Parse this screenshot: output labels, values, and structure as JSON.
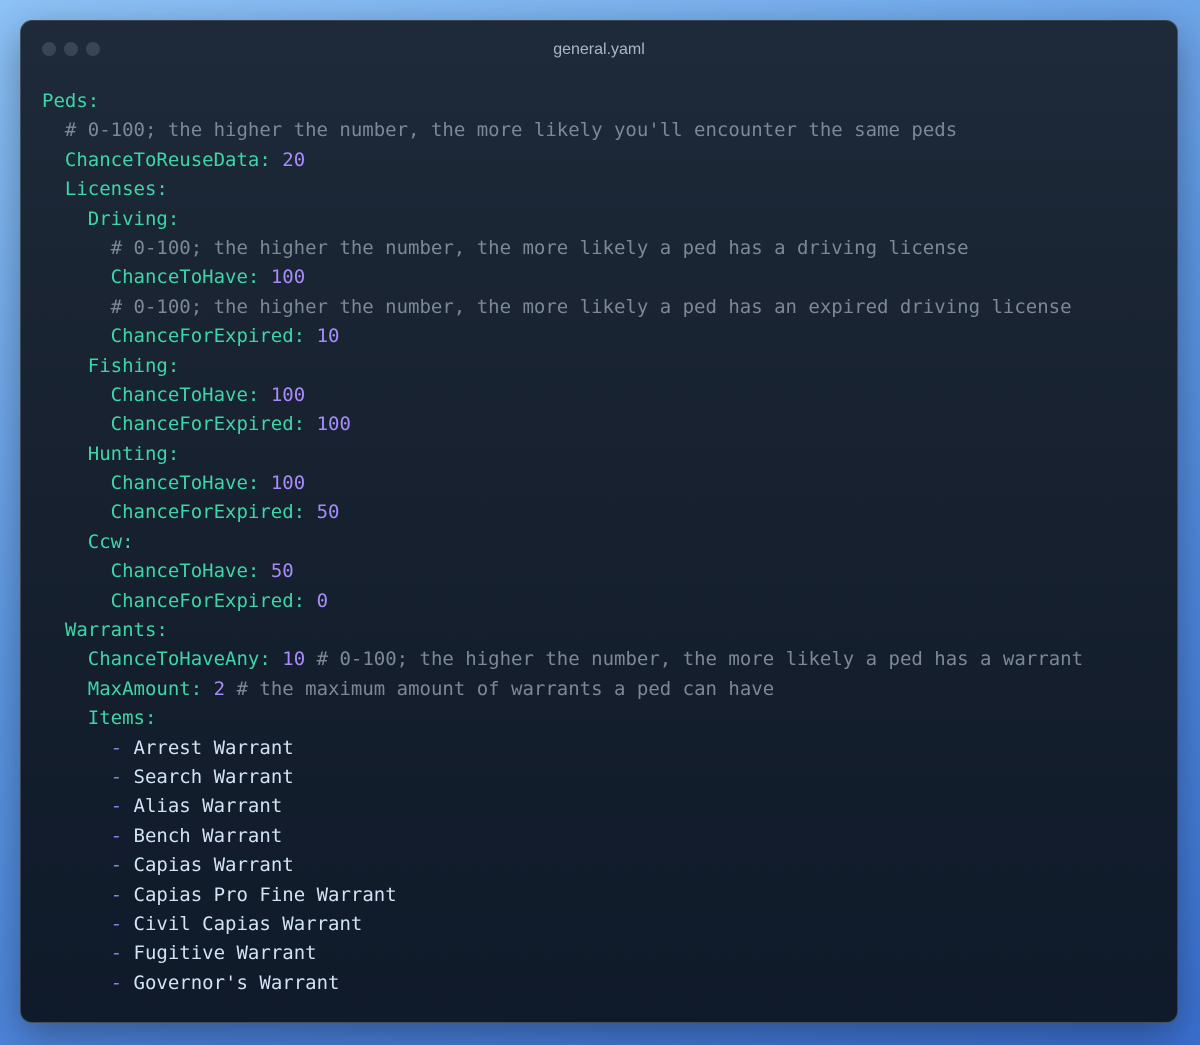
{
  "window": {
    "title": "general.yaml"
  },
  "colors": {
    "key": "#3dd6a8",
    "number": "#a78bfa",
    "comment": "#7d8896",
    "list_dash": "#7c86f0",
    "list_item": "#d2e3f5",
    "window_bg": "#17212f"
  },
  "code": {
    "peds": "Peds:",
    "comment_reuse": "# 0-100; the higher the number, the more likely you'll encounter the same peds",
    "chance_reuse_key": "ChanceToReuseData:",
    "chance_reuse_val": "20",
    "licenses": "Licenses:",
    "driving": "Driving:",
    "comment_driving": "# 0-100; the higher the number, the more likely a ped has a driving license",
    "driving_have_key": "ChanceToHave:",
    "driving_have_val": "100",
    "comment_expired": "# 0-100; the higher the number, the more likely a ped has an expired driving license",
    "driving_expired_key": "ChanceForExpired:",
    "driving_expired_val": "10",
    "fishing": "Fishing:",
    "fishing_have_key": "ChanceToHave:",
    "fishing_have_val": "100",
    "fishing_expired_key": "ChanceForExpired:",
    "fishing_expired_val": "100",
    "hunting": "Hunting:",
    "hunting_have_key": "ChanceToHave:",
    "hunting_have_val": "100",
    "hunting_expired_key": "ChanceForExpired:",
    "hunting_expired_val": "50",
    "ccw": "Ccw:",
    "ccw_have_key": "ChanceToHave:",
    "ccw_have_val": "50",
    "ccw_expired_key": "ChanceForExpired:",
    "ccw_expired_val": "0",
    "warrants": "Warrants:",
    "any_key": "ChanceToHaveAny:",
    "any_val": "10",
    "any_comment": "# 0-100; the higher the number, the more likely a ped has a warrant",
    "max_key": "MaxAmount:",
    "max_val": "2",
    "max_comment": "# the maximum amount of warrants a ped can have",
    "items": "Items:",
    "dash": "-",
    "warrant_items": [
      "Arrest Warrant",
      "Search Warrant",
      "Alias Warrant",
      "Bench Warrant",
      "Capias Warrant",
      "Capias Pro Fine Warrant",
      "Civil Capias Warrant",
      "Fugitive Warrant",
      "Governor's Warrant"
    ]
  }
}
